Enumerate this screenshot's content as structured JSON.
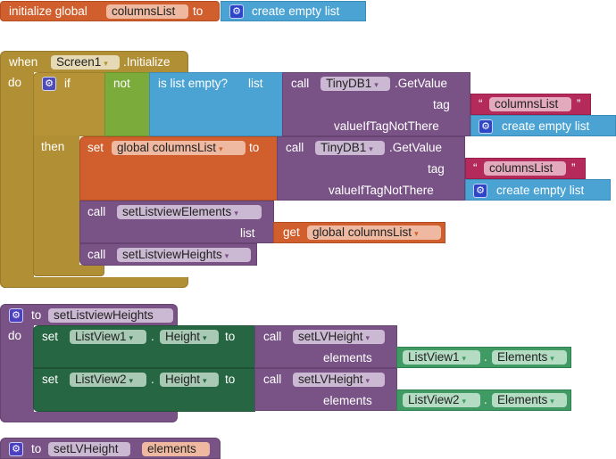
{
  "init_global": {
    "keyword": "initialize global",
    "name": "columnsList",
    "to": "to",
    "value": {
      "icon": "gear-icon",
      "label": "create empty list"
    }
  },
  "screen_init": {
    "when": "when",
    "component": "Screen1",
    "event": ".Initialize",
    "do": "do",
    "if_block": {
      "if": "if",
      "then": "then",
      "not": "not",
      "is_list_empty": "is list empty?",
      "list_label": "list",
      "call": "call",
      "component": "TinyDB1",
      "method": ".GetValue",
      "tag_label": "tag",
      "tag_value": "columnsList",
      "quote_open": "“",
      "quote_close": "”",
      "default_label": "valueIfTagNotThere",
      "default_value": "create empty list"
    },
    "set_block": {
      "set": "set",
      "variable": "global columnsList",
      "to": "to",
      "call": "call",
      "component": "TinyDB1",
      "method": ".GetValue",
      "tag_label": "tag",
      "tag_value": "columnsList",
      "quote_open": "“",
      "quote_close": "”",
      "default_label": "valueIfTagNotThere",
      "default_value": "create empty list"
    },
    "call_elements": {
      "call": "call",
      "procedure": "setListviewElements",
      "arg_label": "list",
      "get": "get",
      "get_var": "global columnsList"
    },
    "call_heights": {
      "call": "call",
      "procedure": "setListviewHeights"
    }
  },
  "proc_heights": {
    "to": "to",
    "name": "setListviewHeights",
    "do": "do",
    "rows": [
      {
        "set": "set",
        "component": "ListView1",
        "dot": ".",
        "property": "Height",
        "to": "to",
        "call": "call",
        "procedure": "setLVHeight",
        "arg_label": "elements",
        "arg_component": "ListView1",
        "arg_property": "Elements"
      },
      {
        "set": "set",
        "component": "ListView2",
        "dot": ".",
        "property": "Height",
        "to": "to",
        "call": "call",
        "procedure": "setLVHeight",
        "arg_label": "elements",
        "arg_component": "ListView2",
        "arg_property": "Elements"
      }
    ]
  },
  "proc_lvheight": {
    "to": "to",
    "name": "setLVHeight",
    "param": "elements"
  },
  "arrow": "▾"
}
